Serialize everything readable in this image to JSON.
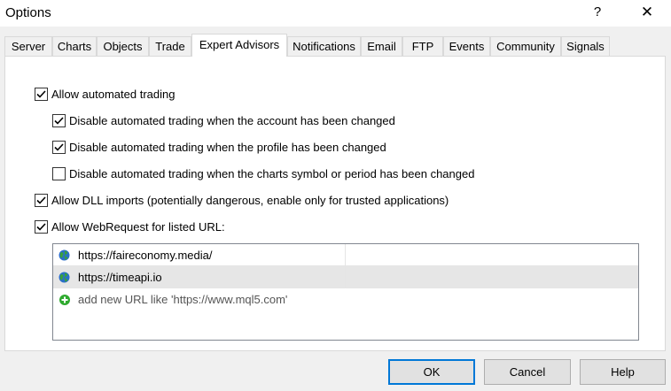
{
  "window": {
    "title": "Options",
    "help_glyph": "?",
    "close_glyph": "✕"
  },
  "tabs": [
    {
      "label": "Server"
    },
    {
      "label": "Charts"
    },
    {
      "label": "Objects"
    },
    {
      "label": "Trade"
    },
    {
      "label": "Expert Advisors",
      "active": true
    },
    {
      "label": "Notifications"
    },
    {
      "label": "Email"
    },
    {
      "label": "FTP"
    },
    {
      "label": "Events"
    },
    {
      "label": "Community"
    },
    {
      "label": "Signals"
    }
  ],
  "options": {
    "allow_automated_trading": {
      "label": "Allow automated trading",
      "checked": true
    },
    "disable_on_account_change": {
      "label": "Disable automated trading when the account has been changed",
      "checked": true
    },
    "disable_on_profile_change": {
      "label": "Disable automated trading when the profile has been changed",
      "checked": true
    },
    "disable_on_symbol_change": {
      "label": "Disable automated trading when the charts symbol or period has been changed",
      "checked": false
    },
    "allow_dll_imports": {
      "label": "Allow DLL imports (potentially dangerous, enable only for trusted applications)",
      "checked": true
    },
    "allow_webrequest": {
      "label": "Allow WebRequest for listed URL:",
      "checked": true
    }
  },
  "url_list": {
    "rows": [
      {
        "url": "https://faireconomy.media/",
        "icon": "globe-icon",
        "selected": false
      },
      {
        "url": "https://timeapi.io",
        "icon": "globe-icon",
        "selected": true
      }
    ],
    "add_prompt": "add new URL like 'https://www.mql5.com'",
    "add_icon": "plus-circle-icon"
  },
  "buttons": {
    "ok": "OK",
    "cancel": "Cancel",
    "help": "Help"
  },
  "colors": {
    "accent": "#0078d7",
    "globe_green": "#3aa23a",
    "globe_blue": "#2a6fc9",
    "add_green": "#2eaa2e"
  }
}
